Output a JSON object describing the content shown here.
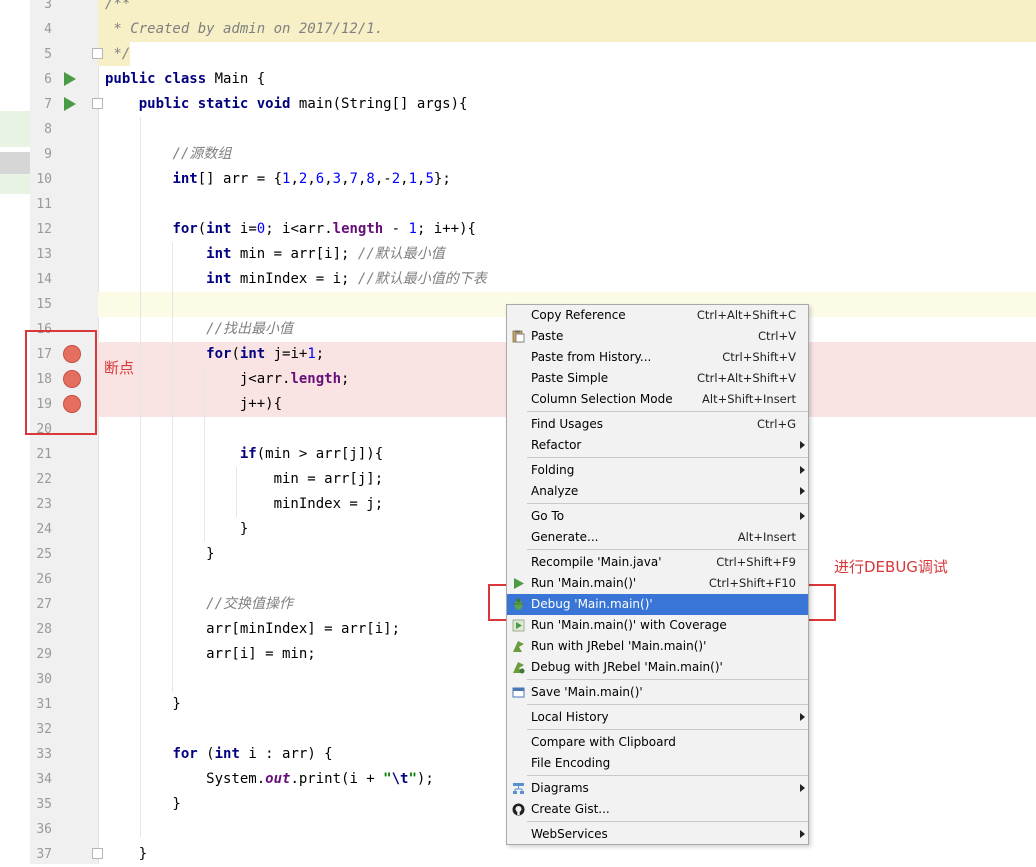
{
  "editor": {
    "lines": [
      {
        "n": "3",
        "text": "/**"
      },
      {
        "n": "4",
        "text": " * Created by admin on 2017/12/1."
      },
      {
        "n": "5",
        "text": " */"
      },
      {
        "n": "6",
        "text": "public class Main {"
      },
      {
        "n": "7",
        "text": "    public static void main(String[] args){"
      },
      {
        "n": "8",
        "text": ""
      },
      {
        "n": "9",
        "text": "        //源数组"
      },
      {
        "n": "10",
        "text": "        int[] arr = {1,2,6,3,7,8,-2,1,5};"
      },
      {
        "n": "11",
        "text": ""
      },
      {
        "n": "12",
        "text": "        for(int i=0; i<arr.length - 1; i++){"
      },
      {
        "n": "13",
        "text": "            int min = arr[i]; //默认最小值"
      },
      {
        "n": "14",
        "text": "            int minIndex = i; //默认最小值的下表"
      },
      {
        "n": "15",
        "text": ""
      },
      {
        "n": "16",
        "text": "            //找出最小值"
      },
      {
        "n": "17",
        "text": "            for(int j=i+1;"
      },
      {
        "n": "18",
        "text": "                j<arr.length;"
      },
      {
        "n": "19",
        "text": "                j++){"
      },
      {
        "n": "20",
        "text": ""
      },
      {
        "n": "21",
        "text": "                if(min > arr[j]){"
      },
      {
        "n": "22",
        "text": "                    min = arr[j];"
      },
      {
        "n": "23",
        "text": "                    minIndex = j;"
      },
      {
        "n": "24",
        "text": "                }"
      },
      {
        "n": "25",
        "text": "            }"
      },
      {
        "n": "26",
        "text": ""
      },
      {
        "n": "27",
        "text": "            //交换值操作"
      },
      {
        "n": "28",
        "text": "            arr[minIndex] = arr[i];"
      },
      {
        "n": "29",
        "text": "            arr[i] = min;"
      },
      {
        "n": "30",
        "text": ""
      },
      {
        "n": "31",
        "text": "        }"
      },
      {
        "n": "32",
        "text": ""
      },
      {
        "n": "33",
        "text": "        for (int i : arr) {"
      },
      {
        "n": "34",
        "text": "            System.out.print(i + \"\\t\");"
      },
      {
        "n": "35",
        "text": "        }"
      },
      {
        "n": "36",
        "text": ""
      },
      {
        "n": "37",
        "text": "    }"
      }
    ],
    "breakpoint_lines": [
      "17",
      "18",
      "19"
    ],
    "run_lines": [
      "6",
      "7"
    ]
  },
  "annotations": {
    "breakpoint_label": "断点",
    "debug_label": "进行DEBUG调试"
  },
  "colors": {
    "keyword": "#000080",
    "comment": "#808080",
    "number": "#0000ff",
    "field": "#660e7a",
    "breakpoint": "#e46f5f",
    "menu_selection": "#3875d7",
    "annotation": "#d9383a"
  },
  "context_menu": {
    "items": [
      {
        "label": "Copy Reference",
        "shortcut": "Ctrl+Alt+Shift+C"
      },
      {
        "label": "Paste",
        "shortcut": "Ctrl+V",
        "icon": "paste-icon"
      },
      {
        "label": "Paste from History...",
        "shortcut": "Ctrl+Shift+V"
      },
      {
        "label": "Paste Simple",
        "shortcut": "Ctrl+Alt+Shift+V"
      },
      {
        "label": "Column Selection Mode",
        "shortcut": "Alt+Shift+Insert"
      },
      {
        "label": "Find Usages",
        "shortcut": "Ctrl+G"
      },
      {
        "label": "Refactor",
        "shortcut": ""
      },
      {
        "label": "Folding",
        "shortcut": ""
      },
      {
        "label": "Analyze",
        "shortcut": ""
      },
      {
        "label": "Go To",
        "shortcut": ""
      },
      {
        "label": "Generate...",
        "shortcut": "Alt+Insert"
      },
      {
        "label": "Recompile 'Main.java'",
        "shortcut": "Ctrl+Shift+F9"
      },
      {
        "label": "Run 'Main.main()'",
        "shortcut": "Ctrl+Shift+F10",
        "icon": "run-icon"
      },
      {
        "label": "Debug 'Main.main()'",
        "shortcut": "",
        "icon": "debug-icon"
      },
      {
        "label": "Run 'Main.main()' with Coverage",
        "shortcut": "",
        "icon": "coverage-icon"
      },
      {
        "label": "Run with JRebel 'Main.main()'",
        "shortcut": "",
        "icon": "jrebel-run-icon"
      },
      {
        "label": "Debug with JRebel 'Main.main()'",
        "shortcut": "",
        "icon": "jrebel-debug-icon"
      },
      {
        "label": "Save 'Main.main()'",
        "shortcut": "",
        "icon": "save-icon"
      },
      {
        "label": "Local History",
        "shortcut": ""
      },
      {
        "label": "Compare with Clipboard",
        "shortcut": ""
      },
      {
        "label": "File Encoding",
        "shortcut": ""
      },
      {
        "label": "Diagrams",
        "shortcut": "",
        "icon": "diagram-icon"
      },
      {
        "label": "Create Gist...",
        "shortcut": "",
        "icon": "github-icon"
      },
      {
        "label": "WebServices",
        "shortcut": ""
      }
    ]
  }
}
